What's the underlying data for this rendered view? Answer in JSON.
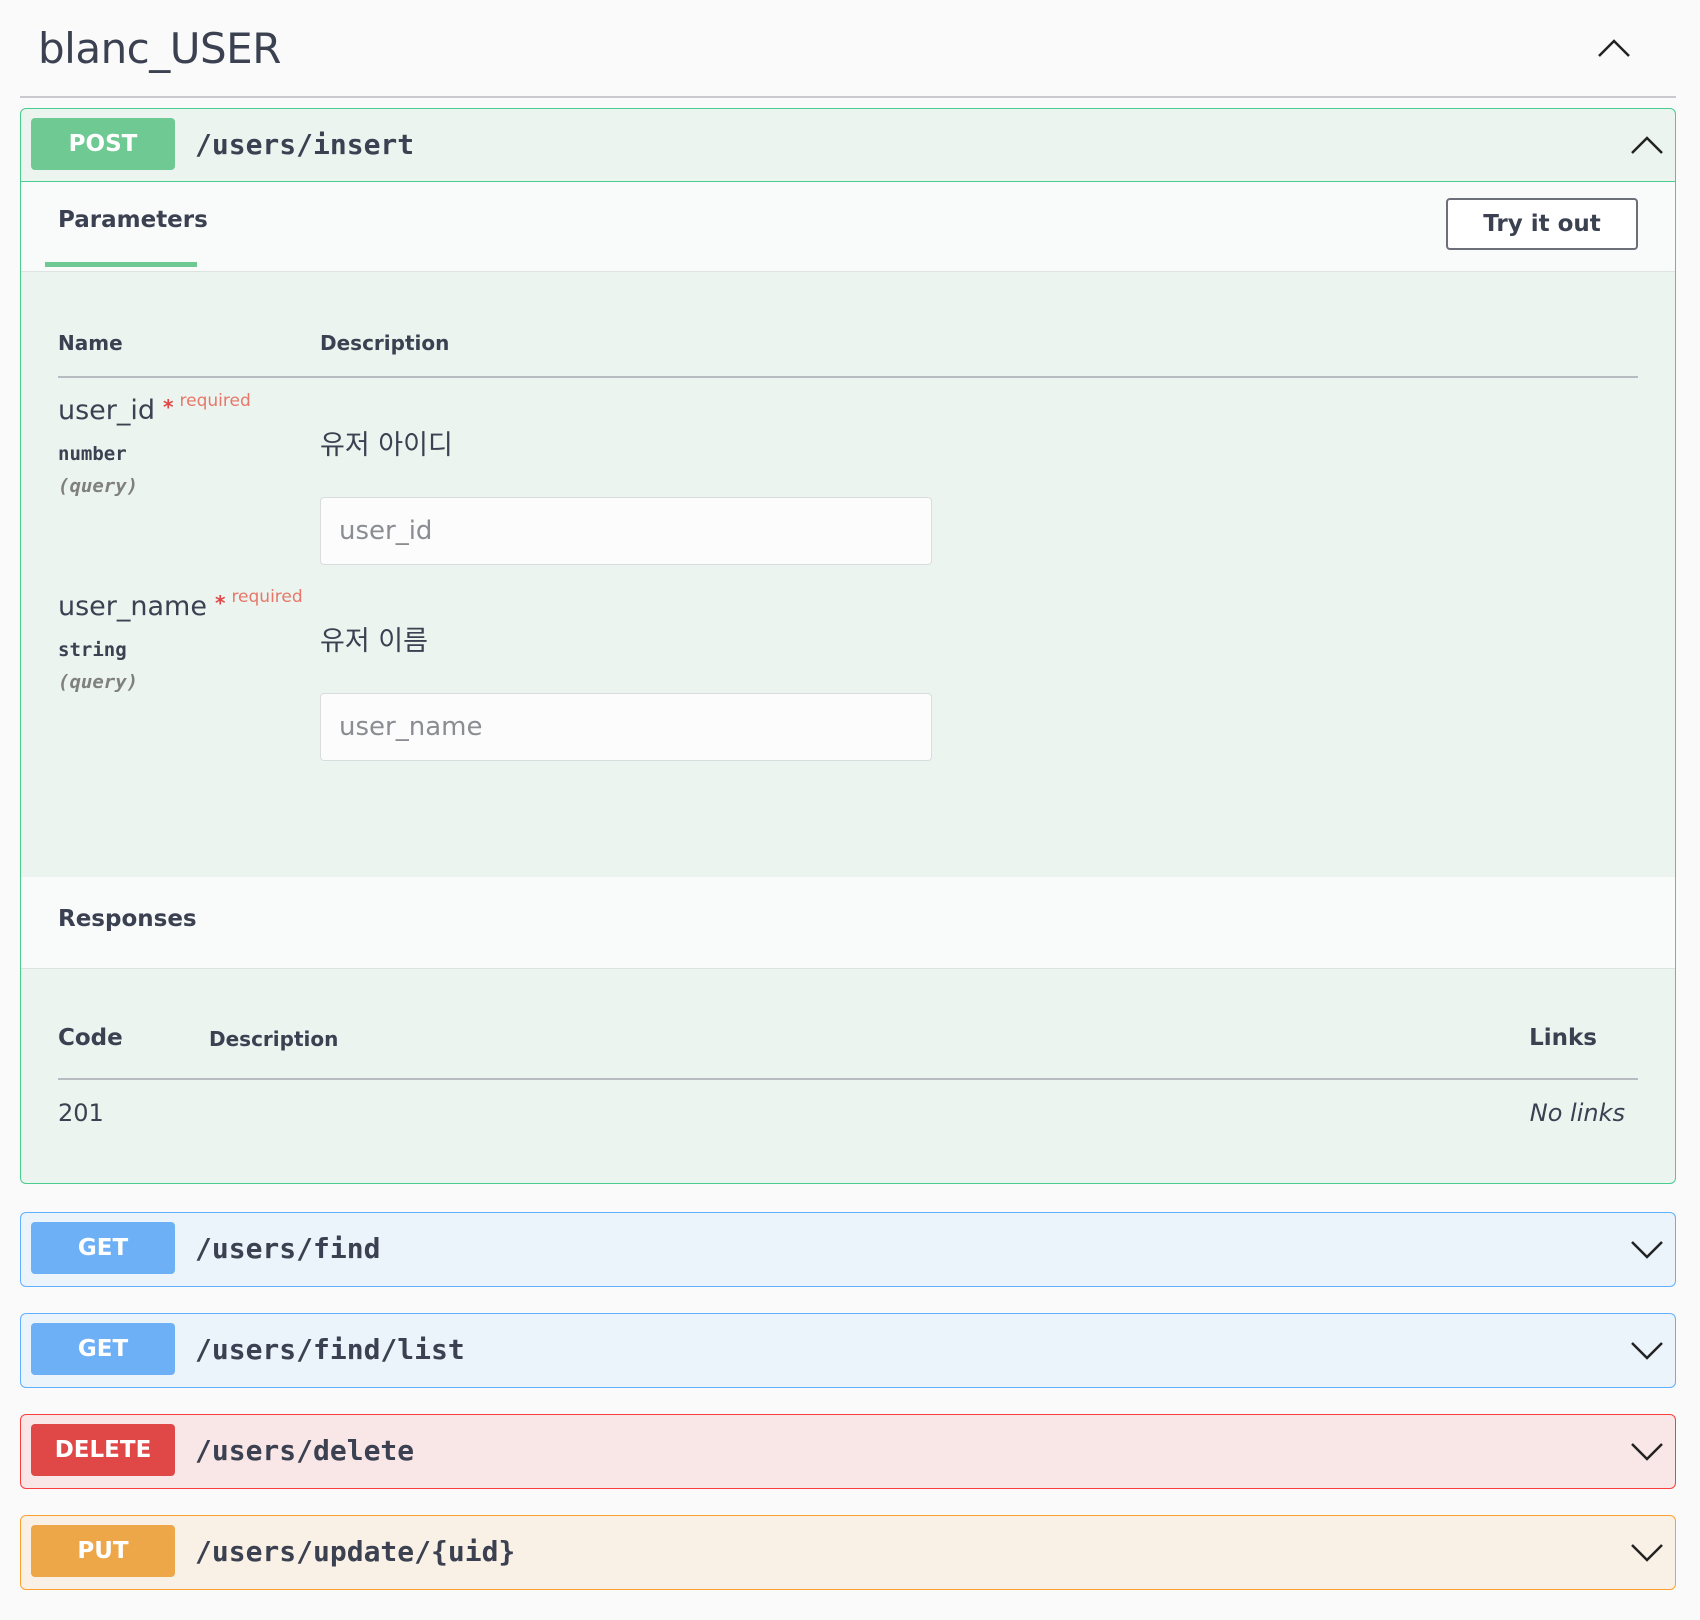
{
  "tag": {
    "title": "blanc_USER"
  },
  "operations": [
    {
      "method": "POST",
      "path": "/users/insert",
      "params_tab": "Parameters",
      "try_button": "Try it out",
      "param_columns": {
        "name": "Name",
        "description": "Description"
      },
      "parameters": [
        {
          "name": "user_id",
          "required_mark": "*",
          "required_label": "required",
          "type": "number",
          "in": "(query)",
          "description": "유저 아이디",
          "placeholder": "user_id"
        },
        {
          "name": "user_name",
          "required_mark": "*",
          "required_label": "required",
          "type": "string",
          "in": "(query)",
          "description": "유저 이름",
          "placeholder": "user_name"
        }
      ],
      "responses_title": "Responses",
      "response_columns": {
        "code": "Code",
        "description": "Description",
        "links": "Links"
      },
      "responses": [
        {
          "code": "201",
          "links": "No links"
        }
      ]
    },
    {
      "method": "GET",
      "path": "/users/find"
    },
    {
      "method": "GET",
      "path": "/users/find/list"
    },
    {
      "method": "DELETE",
      "path": "/users/delete"
    },
    {
      "method": "PUT",
      "path": "/users/update/{uid}"
    }
  ],
  "colors": {
    "post": "#49cc90",
    "get": "#61affe",
    "delete": "#f93e3e",
    "put": "#fca130",
    "text": "#3b4151"
  },
  "icons": {
    "collapse": "chevron-up-icon",
    "expand": "chevron-down-icon"
  }
}
